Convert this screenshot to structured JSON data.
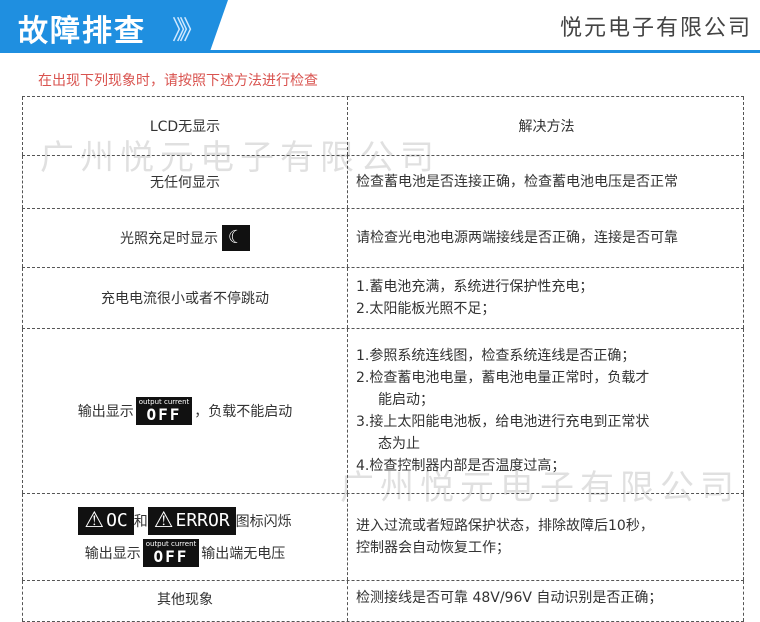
{
  "header": {
    "title": "故障排查",
    "arrows": "》》",
    "company": "悦元电子有限公司"
  },
  "subtitle": "在出现下列现象时，请按照下述方法进行检查",
  "table": {
    "col1_header": "LCD无显示",
    "col2_header": "解决方法",
    "rows": [
      {
        "issue": "无任何显示",
        "solution": [
          "检查蓄电池是否连接正确，检查蓄电池电压是否正常"
        ]
      },
      {
        "issue": "光照充足时显示",
        "moon": "☾",
        "solution": [
          "请检查光电池电源两端接线是否正确，连接是否可靠"
        ]
      },
      {
        "issue": "充电电流很小或者不停跳动",
        "solution": [
          "1.蓄电池充满，系统进行保护性充电；",
          "2.太阳能板光照不足；"
        ]
      },
      {
        "issue_prefix": "输出显示",
        "lcd_small": "output current",
        "lcd_big": "OFF",
        "issue_suffix": "，负载不能启动",
        "solution": [
          "1.参照系统连线图，检查系统连线是否正确；",
          "2.检查蓄电池电量，蓄电池电量正常时，负载才",
          "能启动；",
          "3.接上太阳能电池板，给电池进行充电到正常状",
          "态为止",
          "4.检查控制器内部是否温度过高；"
        ]
      },
      {
        "oc_label": "OC",
        "and": "和",
        "error_label": "ERROR",
        "issue_suffix1": "图标闪烁",
        "issue_prefix2": "输出显示",
        "lcd_small": "output current",
        "lcd_big": "OFF",
        "issue_suffix2": "输出端无电压",
        "solution": [
          "进入过流或者短路保护状态，排除故障后10秒，",
          "控制器会自动恢复工作；"
        ]
      },
      {
        "issue": "其他现象",
        "solution": [
          "检测接线是否可靠 48V/96V 自动识别是否正确；"
        ]
      }
    ]
  },
  "watermark": "广州悦元电子有限公司"
}
